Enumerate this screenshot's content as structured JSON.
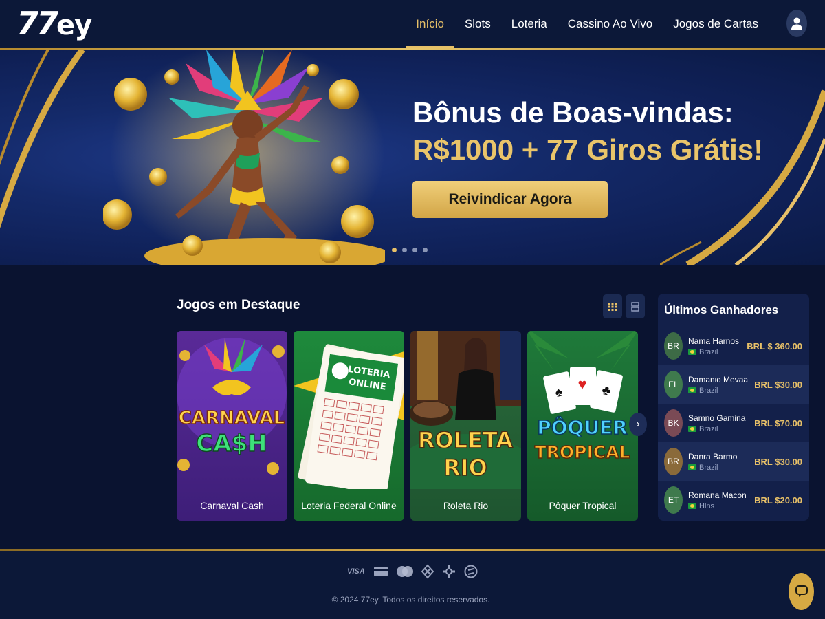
{
  "brand": {
    "logo_seven": "77",
    "logo_ey": "ey"
  },
  "nav": {
    "items": [
      {
        "label": "Início",
        "active": true
      },
      {
        "label": "Slots"
      },
      {
        "label": "Loteria"
      },
      {
        "label": "Cassino Ao Vivo"
      },
      {
        "label": "Jogos de Cartas"
      }
    ]
  },
  "hero": {
    "title_line1": "Bônus de Boas-vindas:",
    "title_line2": "R$1000 + 77 Giros Grátis!",
    "cta": "Reivindicar Agora",
    "slides": 4,
    "active_slide": 1
  },
  "featured": {
    "title": "Jogos em Destaque",
    "games": [
      {
        "name": "Carnaval Cash",
        "art_line1": "CARNAVAL",
        "art_line2": "CA$H"
      },
      {
        "name": "Loteria Federal Online",
        "art_line1": "LOTERIA",
        "art_line2": "ONLINE"
      },
      {
        "name": "Roleta Rio",
        "art_line1": "ROLETA",
        "art_line2": "RIO"
      },
      {
        "name": "Pôquer Tropical",
        "art_line1": "PÔQUER",
        "art_line2": "TROPICAL"
      }
    ]
  },
  "winners": {
    "title": "Últimos Ganhadores",
    "list": [
      {
        "initials": "BR",
        "name": "Nama Harnos",
        "country": "Brazil",
        "amount": "BRL $ 360.00",
        "color": "#3d6b46"
      },
      {
        "initials": "EL",
        "name": "Damanю Mevaa",
        "country": "Brazil",
        "amount": "BRL $30.00",
        "color": "#3f7a4d"
      },
      {
        "initials": "BK",
        "name": "Samno Gamina",
        "country": "Brazil",
        "amount": "BRL $70.00",
        "color": "#7a4a55"
      },
      {
        "initials": "BR",
        "name": "Danra Barmo",
        "country": "Brazil",
        "amount": "BRL $30.00",
        "color": "#8a6a3a"
      },
      {
        "initials": "ET",
        "name": "Romana Macon",
        "country": "Hlns",
        "amount": "BRL $20.00",
        "color": "#3f7a4d"
      }
    ]
  },
  "footer": {
    "payments": [
      "VISA",
      "card-icon",
      "mastercard-icon",
      "pix-icon",
      "boleto-icon",
      "crypto-icon"
    ],
    "visa_label": "VISA",
    "copyright": "© 2024 77ey. Todos os direitos reservados."
  },
  "colors": {
    "gold": "#e7c068",
    "navy": "#0a1330",
    "panel": "#13204a"
  }
}
